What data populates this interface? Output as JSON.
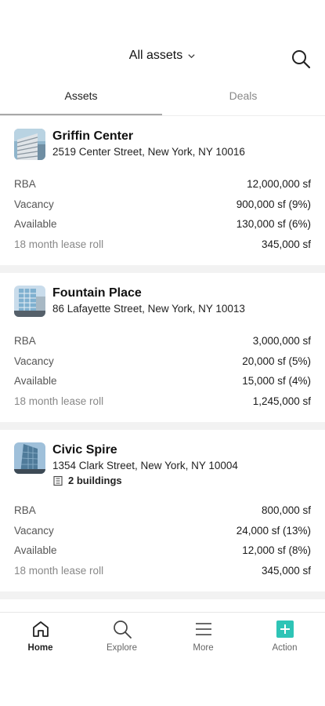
{
  "header": {
    "title": "All assets",
    "search_icon": "search-icon",
    "dropdown_icon": "chevron-down-icon"
  },
  "tabs": [
    {
      "label": "Assets",
      "active": true
    },
    {
      "label": "Deals",
      "active": false
    }
  ],
  "assets": [
    {
      "name": "Griffin Center",
      "address": "2519 Center Street, New York, NY 10016",
      "buildings": null,
      "stats": [
        {
          "label": "RBA",
          "value": "12,000,000 sf"
        },
        {
          "label": "Vacancy",
          "value": "900,000 sf (9%)"
        },
        {
          "label": "Available",
          "value": "130,000 sf (6%)"
        },
        {
          "label": "18 month lease roll",
          "value": "345,000 sf"
        }
      ]
    },
    {
      "name": "Fountain Place",
      "address": "86 Lafayette Street, New York, NY 10013",
      "buildings": null,
      "stats": [
        {
          "label": "RBA",
          "value": "3,000,000 sf"
        },
        {
          "label": "Vacancy",
          "value": "20,000 sf (5%)"
        },
        {
          "label": "Available",
          "value": "15,000 sf (4%)"
        },
        {
          "label": "18 month lease roll",
          "value": "1,245,000 sf"
        }
      ]
    },
    {
      "name": "Civic Spire",
      "address": "1354 Clark Street, New York, NY 10004",
      "buildings": "2 buildings",
      "stats": [
        {
          "label": "RBA",
          "value": "800,000 sf"
        },
        {
          "label": "Vacancy",
          "value": "24,000 sf (13%)"
        },
        {
          "label": "Available",
          "value": "12,000 sf (8%)"
        },
        {
          "label": "18 month lease roll",
          "value": "345,000 sf"
        }
      ]
    }
  ],
  "tabbar": [
    {
      "label": "Home",
      "icon": "home-icon",
      "active": true
    },
    {
      "label": "Explore",
      "icon": "search-icon",
      "active": false
    },
    {
      "label": "More",
      "icon": "menu-icon",
      "active": false
    },
    {
      "label": "Action",
      "icon": "plus-icon",
      "active": false
    }
  ],
  "colors": {
    "accent": "#2ec4b6",
    "separator": "#f2f2f2",
    "muted_text": "#888888"
  }
}
